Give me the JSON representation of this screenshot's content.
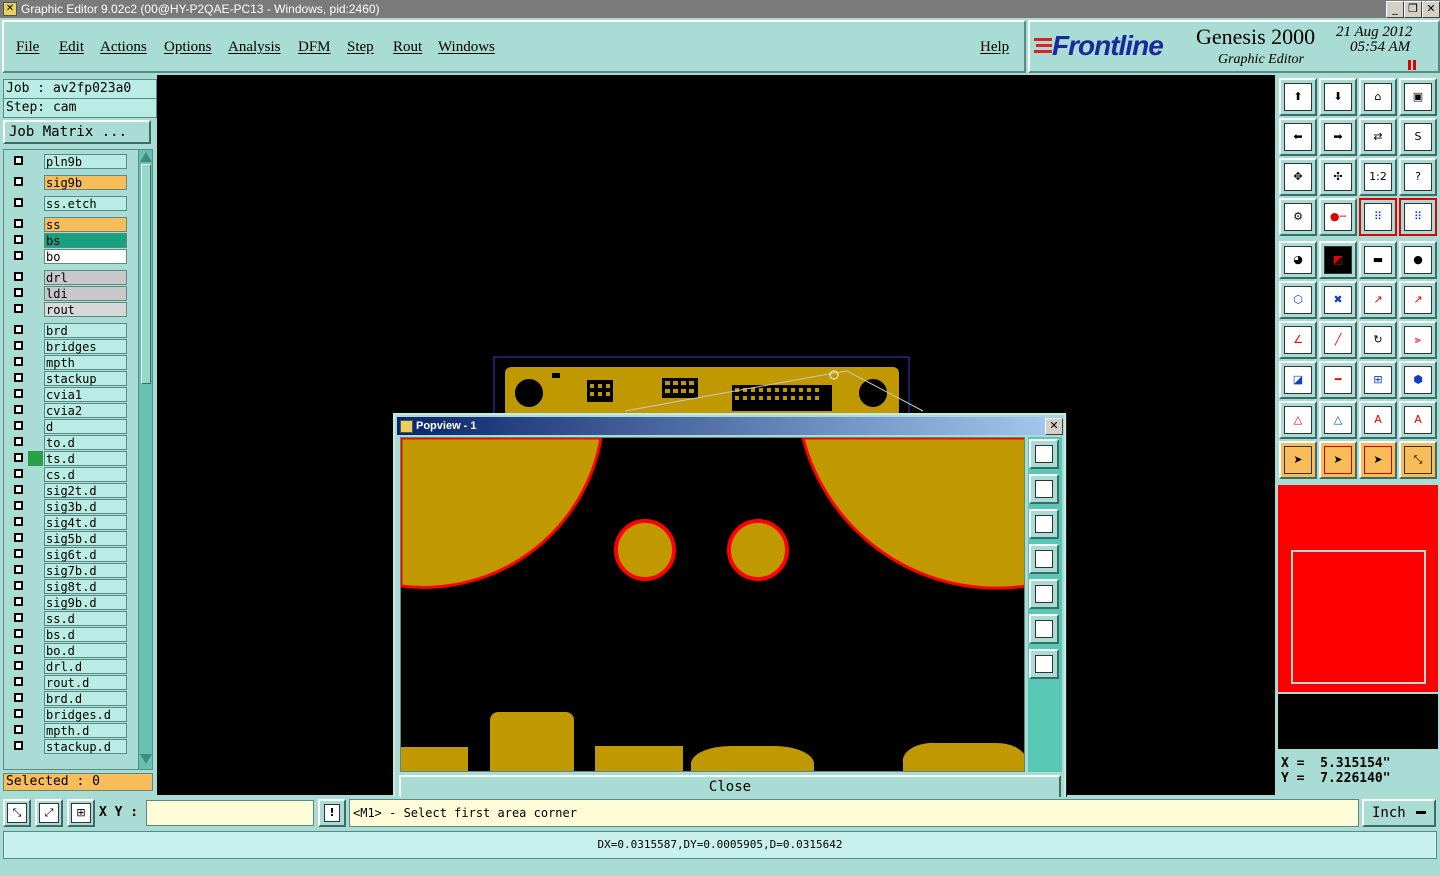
{
  "window": {
    "title": "Graphic Editor 9.02c2 (00@HY-P2QAE-PC13 - Windows, pid:2460)",
    "minimize": "_",
    "restore": "❐",
    "close": "✕"
  },
  "menu": {
    "items": [
      "File",
      "Edit",
      "Actions",
      "Options",
      "Analysis",
      "DFM",
      "Step",
      "Rout",
      "Windows"
    ],
    "help": "Help"
  },
  "logo": {
    "brand": "Frontline",
    "product": "Genesis 2000",
    "subtitle": "Graphic Editor",
    "date": "21 Aug 2012",
    "time": "05:54 AM"
  },
  "job": {
    "job_label": "Job : av2fp023a0",
    "step_label": "Step: cam",
    "matrix_button": "Job Matrix ...",
    "selected": "Selected : 0"
  },
  "layers": [
    {
      "name": "pln9b",
      "color": "#b8ece4"
    },
    {
      "name": "sig9b",
      "color": "#f8bc58"
    },
    {
      "name": "ss.etch",
      "color": "#b8ece4"
    },
    {
      "name": "ss",
      "color": "#f8bc58"
    },
    {
      "name": "bs",
      "color": "#18a080"
    },
    {
      "name": "bo",
      "color": "#ffffff"
    },
    {
      "name": "drl",
      "color": "#c8c8c8"
    },
    {
      "name": "ldi",
      "color": "#c8c8c8"
    },
    {
      "name": "rout",
      "color": "#d8d8d8"
    },
    {
      "name": "brd",
      "color": "#b8ece4"
    },
    {
      "name": "bridges",
      "color": "#b8ece4"
    },
    {
      "name": "mpth",
      "color": "#b8ece4"
    },
    {
      "name": "stackup",
      "color": "#b8ece4"
    },
    {
      "name": "cvia1",
      "color": "#b8ece4"
    },
    {
      "name": "cvia2",
      "color": "#b8ece4"
    },
    {
      "name": "d",
      "color": "#b8ece4"
    },
    {
      "name": "to.d",
      "color": "#b8ece4"
    },
    {
      "name": "ts.d",
      "color": "#b8ece4"
    },
    {
      "name": "cs.d",
      "color": "#b8ece4"
    },
    {
      "name": "sig2t.d",
      "color": "#b8ece4"
    },
    {
      "name": "sig3b.d",
      "color": "#b8ece4"
    },
    {
      "name": "sig4t.d",
      "color": "#b8ece4"
    },
    {
      "name": "sig5b.d",
      "color": "#b8ece4"
    },
    {
      "name": "sig6t.d",
      "color": "#b8ece4"
    },
    {
      "name": "sig7b.d",
      "color": "#b8ece4"
    },
    {
      "name": "sig8t.d",
      "color": "#b8ece4"
    },
    {
      "name": "sig9b.d",
      "color": "#b8ece4"
    },
    {
      "name": "ss.d",
      "color": "#b8ece4"
    },
    {
      "name": "bs.d",
      "color": "#b8ece4"
    },
    {
      "name": "bo.d",
      "color": "#b8ece4"
    },
    {
      "name": "drl.d",
      "color": "#b8ece4"
    },
    {
      "name": "rout.d",
      "color": "#b8ece4"
    },
    {
      "name": "brd.d",
      "color": "#b8ece4"
    },
    {
      "name": "bridges.d",
      "color": "#b8ece4"
    },
    {
      "name": "mpth.d",
      "color": "#b8ece4"
    },
    {
      "name": "stackup.d",
      "color": "#b8ece4"
    }
  ],
  "popview": {
    "title": "Popview - 1",
    "close_button": "Close",
    "close_x": "✕"
  },
  "toolbar": {
    "ratio_label": "1:2",
    "help_label": "?"
  },
  "coords": {
    "x": "X =  5.315154\"",
    "y": "Y =  7.226140\""
  },
  "status": {
    "xy_label": "X Y :",
    "xy_value": "",
    "warn_icon": "!",
    "prompt": "<M1> - Select first area corner",
    "units": "Inch",
    "measurement": "DX=0.0315587,DY=0.0005905,D=0.0315642"
  },
  "colors": {
    "panel": "#a8dcd4",
    "copper": "#c09800",
    "highlight": "#ff0000",
    "canvas": "#000000"
  }
}
